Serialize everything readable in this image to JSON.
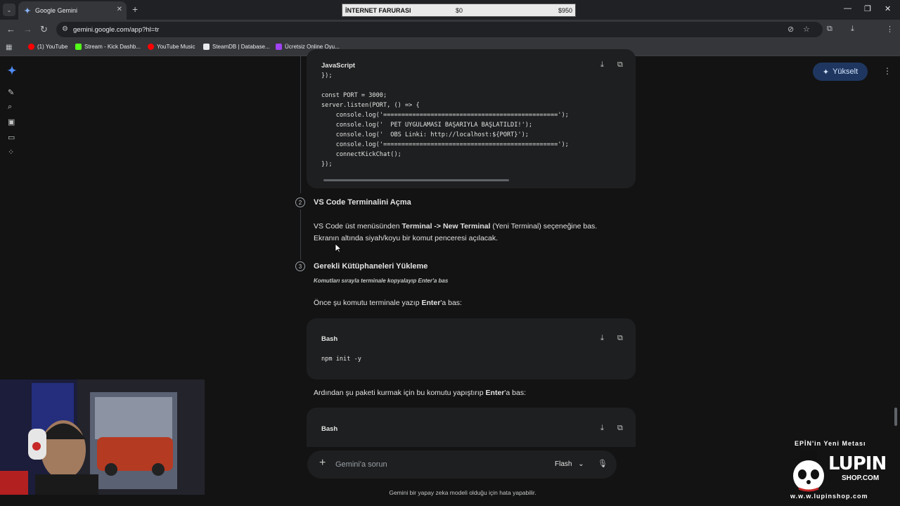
{
  "browser": {
    "tab_title": "Google Gemini",
    "url": "gemini.google.com/app?hl=tr",
    "bookmarks": [
      {
        "label": "(1) YouTube",
        "color": "#ff0000"
      },
      {
        "label": "Stream - Kick Dashb...",
        "color": "#53fc18"
      },
      {
        "label": "YouTube Music",
        "color": "#ff0000"
      },
      {
        "label": "SteamDB | Database...",
        "color": "#e8eaed"
      },
      {
        "label": "Ücretsiz Online Oyu...",
        "color": "#a142f4"
      }
    ]
  },
  "overlay": {
    "label": "İNTERNET FARURASI",
    "current": "$0",
    "target": "$950"
  },
  "gemini": {
    "upgrade_label": "Yükselt",
    "code_block_1": {
      "language": "JavaScript",
      "lines": [
        "});",
        "",
        "const PORT = 3000;",
        "server.listen(PORT, () => {",
        "    console.log('================================================');",
        "    console.log('  PET UYGULAMASI BAŞARIYLA BAŞLATILDI!');",
        "    console.log('  OBS Linki: http://localhost:${PORT}');",
        "    console.log('================================================');",
        "    connectKickChat();",
        "});"
      ]
    },
    "step2": {
      "number": "2",
      "title": "VS Code Terminalini Açma",
      "text_a": "VS Code üst menüsünden ",
      "bold_a": "Terminal -> New Terminal",
      "text_b": " (Yeni Terminal) seçeneğine bas.",
      "text_c": "Ekranın altında siyah/koyu bir komut penceresi açılacak."
    },
    "step3": {
      "number": "3",
      "title": "Gerekli Kütüphaneleri Yükleme",
      "note": "Komutları sırayla terminale kopyalayıp Enter'a bas",
      "text1_a": "Önce şu komutu terminale yazıp ",
      "text1_bold": "Enter",
      "text1_b": "'a bas:",
      "code2": {
        "language": "Bash",
        "line": "npm init -y"
      },
      "text2_a": "Ardından şu paketi kurmak için bu komutu yapıştırıp ",
      "text2_bold": "Enter",
      "text2_b": "'a bas:",
      "code3": {
        "language": "Bash"
      }
    },
    "composer": {
      "placeholder": "Gemini'a sorun",
      "model": "Flash"
    },
    "disclaimer": "Gemini bir yapay zeka modeli olduğu için hata yapabilir."
  },
  "brand_overlay": {
    "tagline": "EPİN'in Yeni Metası",
    "name_top": "LUPIN",
    "name_bottom": "SHOP.COM",
    "url": "w.w.w.lupinshop.com"
  }
}
